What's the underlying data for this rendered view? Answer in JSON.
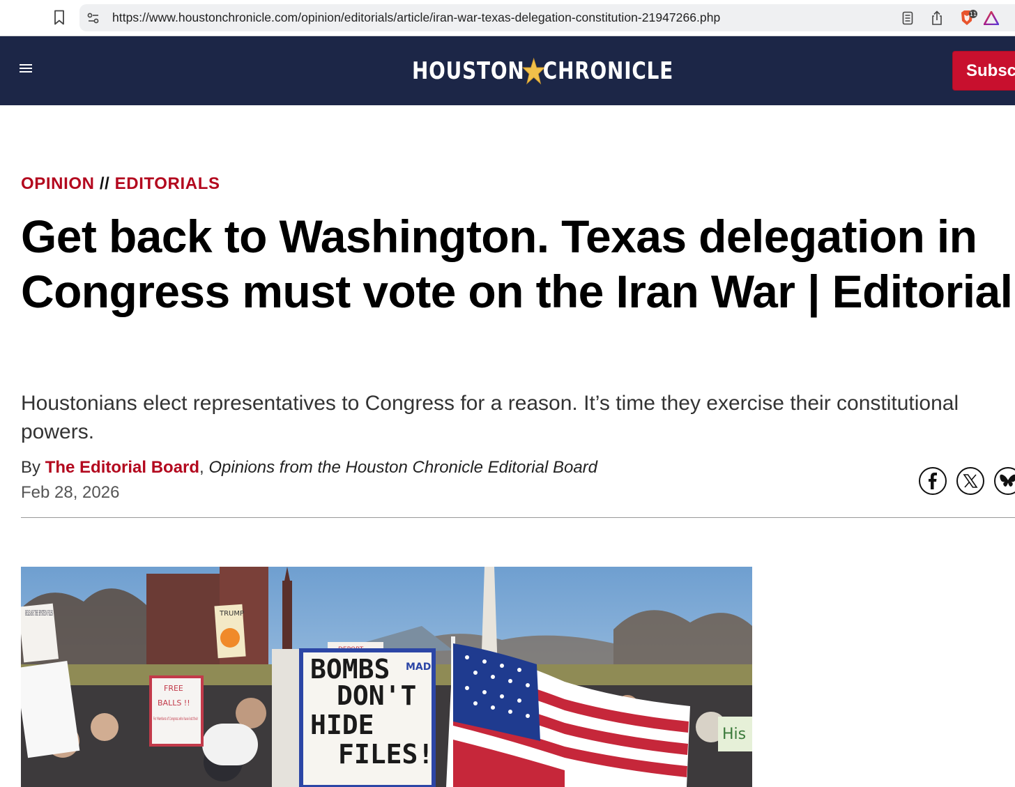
{
  "browser": {
    "url": "https://www.houstonchronicle.com/opinion/editorials/article/iran-war-texas-delegation-constitution-21947266.php",
    "brave_badge": "11"
  },
  "header": {
    "logo_left": "HOUSTON",
    "logo_right": "CHRONICLE",
    "subscribe_label": "Subscribe",
    "bg_color": "#1c2647",
    "accent_color": "#c8102e"
  },
  "article": {
    "section": "OPINION",
    "separator": "//",
    "subsection": "EDITORIALS",
    "headline": "Get back to Washington. Texas delegation in Congress must vote on the Iran War | Editorial",
    "dek": "Houstonians elect representatives to Congress for a reason. It’s time they exercise their constitutional powers.",
    "byline_prefix": "By",
    "author": "The Editorial Board",
    "author_affiliation": "Opinions from the Houston Chronicle Editorial Board",
    "date": "Feb 28, 2026"
  },
  "share": [
    "facebook-icon",
    "x-icon",
    "bluesky-icon"
  ],
  "hero_image": {
    "signs": {
      "bombs": "BOMBS",
      "dont": "DON'T",
      "hide": "HIDE",
      "files": "FILES!",
      "mad": "MAD",
      "deport": "DEPORT",
      "free": "FREE",
      "balls": "BALLS !!",
      "members": "For Members of Congress who have lost their",
      "trump": "TRUMP",
      "release": "RELEASE THE EPSTEIN FILES",
      "his": "His"
    }
  }
}
